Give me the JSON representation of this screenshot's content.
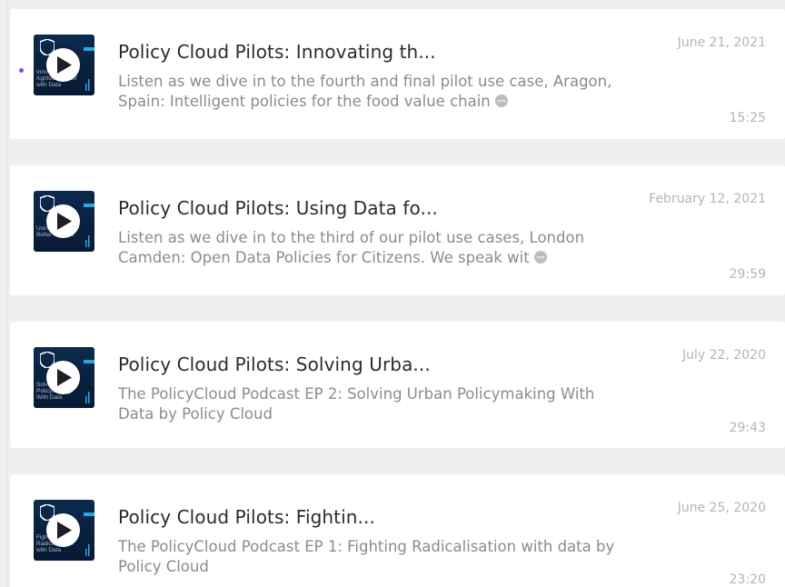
{
  "colors": {
    "accent_unplayed_dot": "#8a3ff0",
    "thumbnail_bg": "#0c2a4f",
    "title_text": "#2a2a33",
    "description_text": "#8a8a94",
    "meta_text": "#b4b4bb",
    "page_bg": "#efefef"
  },
  "icons": {
    "play": "play-icon",
    "more": "more-icon",
    "shield_logo": "shield-logo-icon"
  },
  "episodes": [
    {
      "title": "Policy Cloud Pilots: Innovating th...",
      "description": "Listen as we dive in to the fourth and final pilot use case, Aragon, Spain: Intelligent policies for the food value chain",
      "has_more": true,
      "date": "June 21, 2021",
      "duration": "15:25",
      "unplayed": true,
      "thumbnail_text": "Innovating the Agrifood Sector with Data"
    },
    {
      "title": "Policy Cloud Pilots: Using Data fo...",
      "description": "Listen as we dive in to the third of our pilot use cases, London Camden: Open Data Policies for Citizens. We speak wit",
      "has_more": true,
      "date": "February 12, 2021",
      "duration": "29:59",
      "unplayed": false,
      "thumbnail_text": "Using Data for Better Policies"
    },
    {
      "title": "Policy Cloud Pilots: Solving Urba...",
      "description": "The PolicyCloud Podcast EP 2: Solving Urban Policymaking With Data by Policy Cloud",
      "has_more": false,
      "date": "July 22, 2020",
      "duration": "29:43",
      "unplayed": false,
      "thumbnail_text": "Solving Urban Policymaking With Data"
    },
    {
      "title": "Policy Cloud Pilots: Fightin...",
      "description": "The PolicyCloud Podcast EP 1: Fighting Radicalisation with data by Policy Cloud",
      "has_more": false,
      "date": "June 25, 2020",
      "duration": "23:20",
      "unplayed": false,
      "thumbnail_text": "Fighting Radicalisation with Data"
    }
  ]
}
